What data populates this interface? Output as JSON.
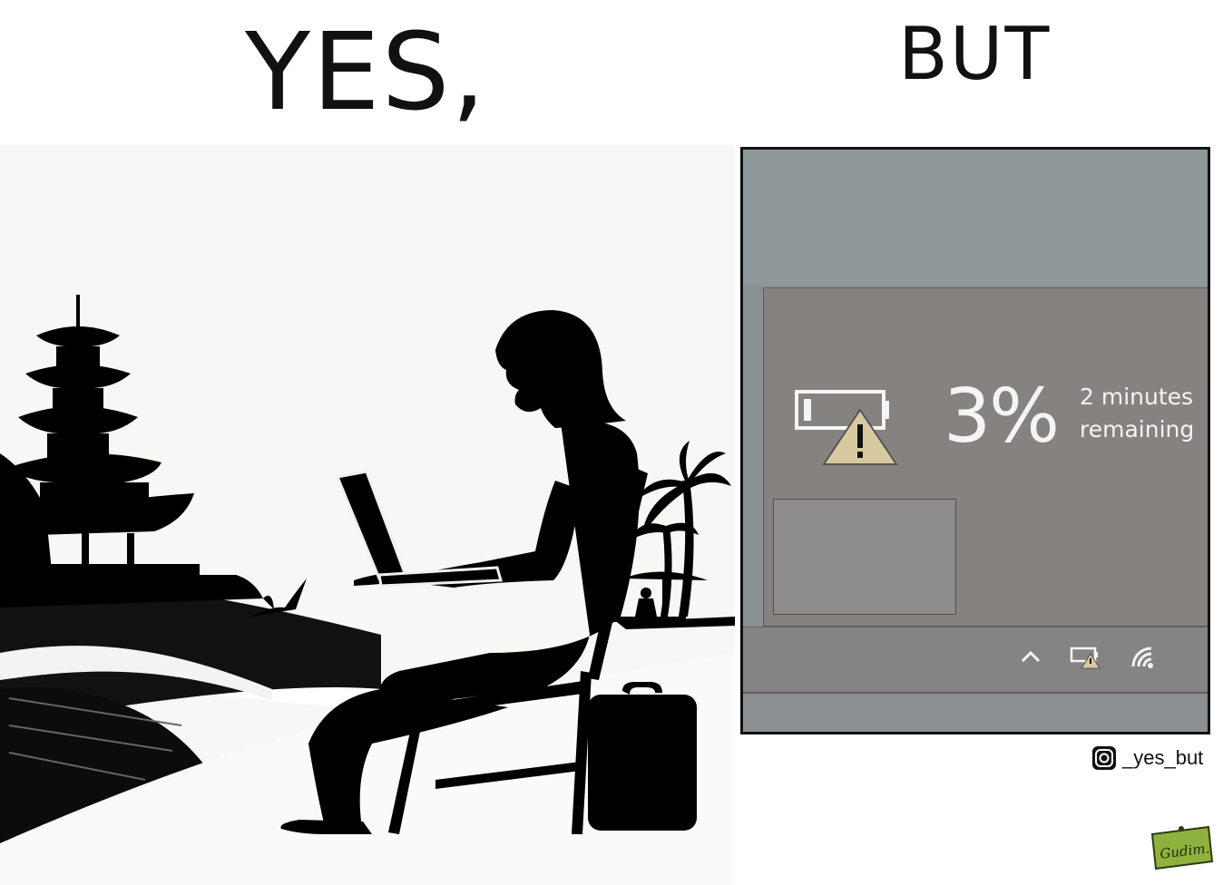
{
  "left_panel": {
    "caption": "YES,",
    "icons": [
      "pagoda-icon",
      "palm-tree-icon",
      "bird-icon",
      "laptop-icon",
      "backpack-icon",
      "beach-umbrella-icon"
    ]
  },
  "right_panel": {
    "caption": "BUT",
    "battery_flyout": {
      "percent": "3%",
      "remaining_line1": "2 minutes",
      "remaining_line2": "remaining",
      "icon": "battery-low-warning-icon"
    },
    "taskbar": {
      "icons": [
        "chevron-up-icon",
        "battery-warning-icon",
        "wifi-icon"
      ]
    }
  },
  "credit": {
    "handle": "_yes_but",
    "icon": "instagram-icon",
    "signature": "Gudim."
  },
  "colors": {
    "silhouette": "#000000",
    "warning_triangle": "#d8c9a0",
    "panel_bg": "#858280"
  }
}
